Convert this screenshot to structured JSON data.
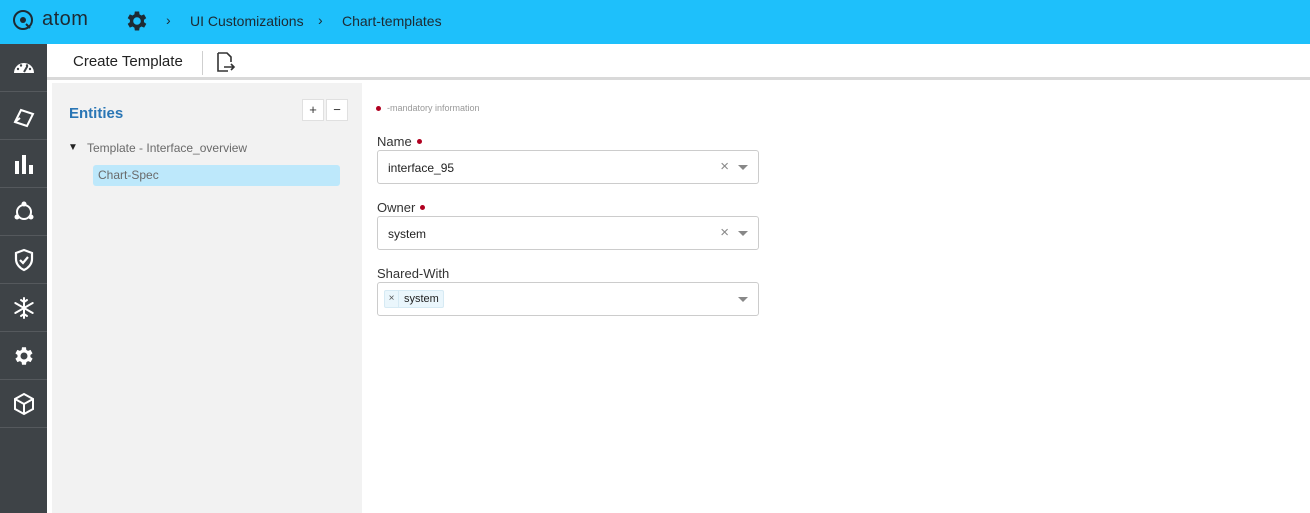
{
  "app": {
    "logo_text": "atom"
  },
  "breadcrumb": {
    "items": [
      {
        "label": "UI Customizations"
      },
      {
        "label": "Chart-templates"
      }
    ]
  },
  "toolbar": {
    "create_label": "Create Template"
  },
  "nav": {
    "items": [
      {
        "icon": "dashboard-icon"
      },
      {
        "icon": "inventory-icon"
      },
      {
        "icon": "bar-chart-icon"
      },
      {
        "icon": "workflow-icon"
      },
      {
        "icon": "shield-icon"
      },
      {
        "icon": "snowflake-icon"
      },
      {
        "icon": "gear-icon"
      },
      {
        "icon": "cube-icon"
      }
    ]
  },
  "entities": {
    "title": "Entities",
    "add_label": "+",
    "remove_label": "−",
    "tree": {
      "parent": "Template - Interface_overview",
      "child": "Chart-Spec"
    }
  },
  "form": {
    "mandatory_note": "-mandatory information",
    "name": {
      "label": "Name",
      "value": "interface_95"
    },
    "owner": {
      "label": "Owner",
      "value": "system"
    },
    "shared_with": {
      "label": "Shared-With",
      "chips": [
        "system"
      ]
    }
  },
  "colors": {
    "topbar": "#1ec0fb",
    "leftnav": "#3e4347",
    "entities_title": "#2a76b5",
    "selected_item": "#bde8fb",
    "mandatory_dot": "#b00020"
  }
}
